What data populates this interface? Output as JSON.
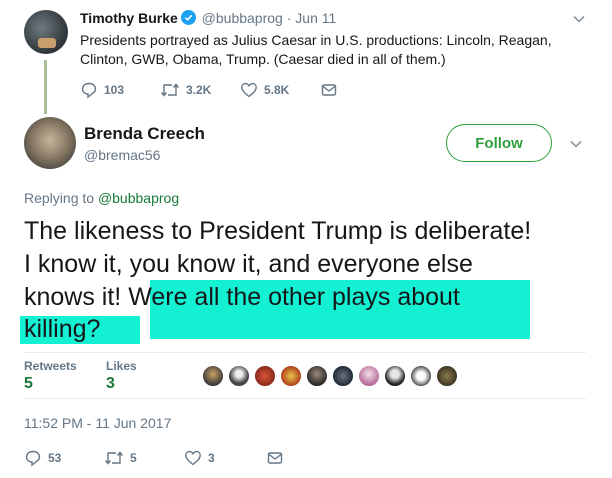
{
  "parent_tweet": {
    "name": "Timothy Burke",
    "handle": "@bubbaprog",
    "separator": "·",
    "date": "Jun 11",
    "text": "Presidents portrayed as Julius Caesar in U.S. productions: Lincoln, Reagan, Clinton, GWB, Obama, Trump. (Caesar died in all of them.)",
    "actions": {
      "reply_count": "103",
      "retweet_count": "3.2K",
      "like_count": "5.8K"
    },
    "icons": [
      "verified-badge-icon",
      "reply-icon",
      "retweet-icon",
      "like-icon",
      "message-icon",
      "chevron-down-icon"
    ]
  },
  "main_tweet": {
    "name": "Brenda Creech",
    "handle": "@bremac56",
    "follow_label": "Follow",
    "reply_prefix": "Replying to ",
    "reply_handle": "@bubbaprog",
    "text_lines": [
      "The likeness to President Trump is deliberate!",
      "I know it, you know it, and everyone else",
      "knows it! ",
      "Were all the other plays about",
      "killing?"
    ],
    "stats": {
      "retweets_label": "Retweets",
      "retweets_value": "5",
      "likes_label": "Likes",
      "likes_value": "3"
    },
    "timestamp": "11:52 PM - 11 Jun 2017",
    "actions": {
      "reply_count": "53",
      "retweet_count": "5",
      "like_count": "3"
    }
  },
  "colors": {
    "accent_green": "#1b7a3a",
    "follow_border": "#2e9e3c",
    "highlight": "#14f0d2",
    "muted": "#657786",
    "verified_blue": "#1da1f2"
  }
}
